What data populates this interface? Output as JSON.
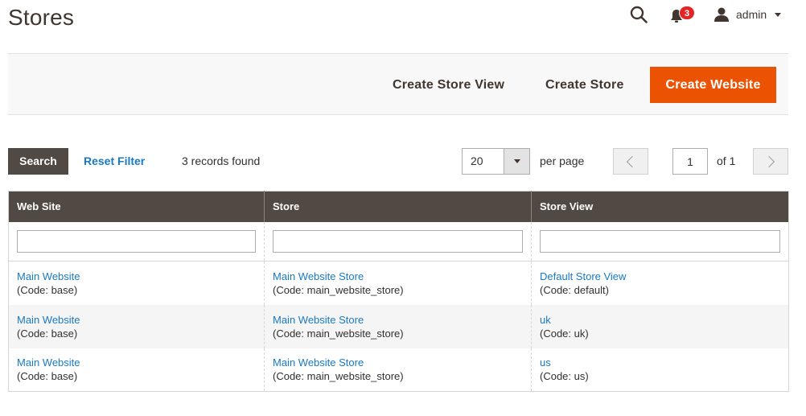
{
  "page": {
    "title": "Stores"
  },
  "header": {
    "notifications_count": "3",
    "user_name": "admin"
  },
  "actions": {
    "create_store_view": "Create Store View",
    "create_store": "Create Store",
    "create_website": "Create Website"
  },
  "toolbar": {
    "search_label": "Search",
    "reset_filter_label": "Reset Filter",
    "records_found": "3 records found",
    "per_page_value": "20",
    "per_page_label": "per page",
    "current_page": "1",
    "page_of": "of 1"
  },
  "grid": {
    "columns": [
      "Web Site",
      "Store",
      "Store View"
    ],
    "rows": [
      {
        "website": "Main Website",
        "website_code": "(Code: base)",
        "store": "Main Website Store",
        "store_code": "(Code: main_website_store)",
        "store_view": "Default Store View",
        "store_view_code": "(Code: default)"
      },
      {
        "website": "Main Website",
        "website_code": "(Code: base)",
        "store": "Main Website Store",
        "store_code": "(Code: main_website_store)",
        "store_view": "uk",
        "store_view_code": "(Code: uk)"
      },
      {
        "website": "Main Website",
        "website_code": "(Code: base)",
        "store": "Main Website Store",
        "store_code": "(Code: main_website_store)",
        "store_view": "us",
        "store_view_code": "(Code: us)"
      }
    ]
  },
  "colors": {
    "primary": "#eb5202",
    "header_bg": "#514943",
    "link": "#1979c3",
    "badge": "#e22626"
  },
  "icons": {
    "search": "search-icon",
    "notifications": "bell-icon",
    "user": "user-icon",
    "dropdown": "caret-down-icon",
    "prev": "chevron-left-icon",
    "next": "chevron-right-icon"
  }
}
